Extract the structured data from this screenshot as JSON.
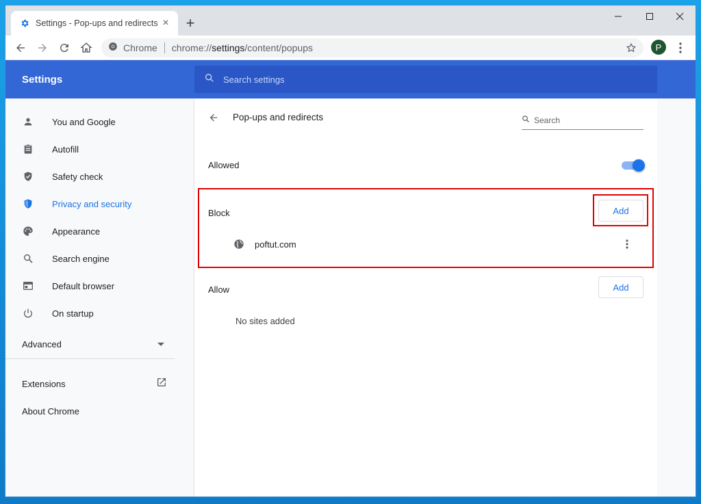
{
  "browser": {
    "tab": {
      "title": "Settings - Pop-ups and redirects",
      "favicon": "gear-icon",
      "close": "×"
    },
    "new_tab": "+",
    "window_controls": {
      "minimize": "–",
      "maximize": "☐",
      "close": "✕"
    },
    "omnibox": {
      "site_label": "Chrome",
      "url_prefix": "chrome://",
      "url_host": "settings",
      "url_path": "/content/popups"
    },
    "profile_initial": "P"
  },
  "settings": {
    "header_title": "Settings",
    "search_placeholder": "Search settings",
    "sidebar": {
      "items": [
        {
          "label": "You and Google",
          "icon": "person-icon"
        },
        {
          "label": "Autofill",
          "icon": "clipboard-icon"
        },
        {
          "label": "Safety check",
          "icon": "shield-check-icon"
        },
        {
          "label": "Privacy and security",
          "icon": "shield-icon",
          "active": true
        },
        {
          "label": "Appearance",
          "icon": "palette-icon"
        },
        {
          "label": "Search engine",
          "icon": "search-icon"
        },
        {
          "label": "Default browser",
          "icon": "browser-icon"
        },
        {
          "label": "On startup",
          "icon": "power-icon"
        }
      ],
      "advanced": "Advanced",
      "extensions": "Extensions",
      "about": "About Chrome"
    },
    "page": {
      "title": "Pop-ups and redirects",
      "search_placeholder": "Search",
      "allowed_label": "Allowed",
      "allowed_enabled": true,
      "block": {
        "label": "Block",
        "add": "Add",
        "sites": [
          "poftut.com"
        ]
      },
      "allow": {
        "label": "Allow",
        "add": "Add",
        "empty": "No sites added"
      }
    },
    "colors": {
      "accent": "#1a73e8",
      "header": "#3367d6",
      "highlight": "#e00000"
    }
  }
}
